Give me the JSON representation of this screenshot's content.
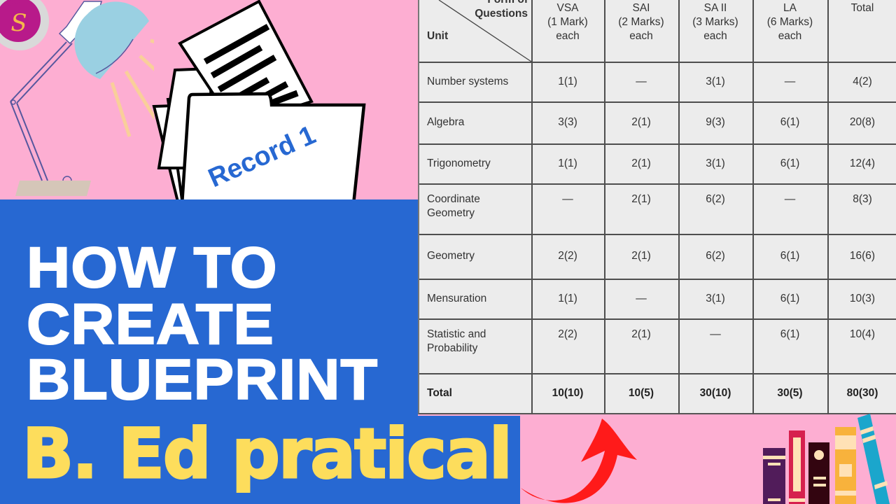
{
  "logo": {
    "letter": "S",
    "name": "channel-logo"
  },
  "folder_label": "Record 1",
  "headline": [
    "HOW TO",
    "CREATE",
    "BLUEPRINT"
  ],
  "subtitle": "B. Ed pratical",
  "colors": {
    "pink_background": "#fdaed2",
    "blue_panel": "#2768d2",
    "headline_text": "#ffffff",
    "subtitle_text": "#fddd5c",
    "folder_text": "#2768d2",
    "arrow": "#ff1a1a",
    "table_background": "#ececec"
  },
  "blueprint_table": {
    "corner_header": {
      "top": "Form of Questions",
      "top_line1": "Form of",
      "top_line2": "Questions",
      "bottom": "Unit"
    },
    "columns": [
      {
        "lines": [
          "VSA",
          "(1 Mark)",
          "each"
        ]
      },
      {
        "lines": [
          "SAI",
          "(2 Marks)",
          "each"
        ]
      },
      {
        "lines": [
          "SA II",
          "(3 Marks)",
          "each"
        ]
      },
      {
        "lines": [
          "LA",
          "(6 Marks)",
          "each"
        ]
      },
      {
        "lines": [
          "Total"
        ]
      }
    ],
    "rows": [
      {
        "unit": [
          "Number systems"
        ],
        "values": [
          "1(1)",
          "—",
          "3(1)",
          "—",
          "4(2)"
        ]
      },
      {
        "unit": [
          "Algebra"
        ],
        "values": [
          "3(3)",
          "2(1)",
          "9(3)",
          "6(1)",
          "20(8)"
        ]
      },
      {
        "unit": [
          "Trigonometry"
        ],
        "values": [
          "1(1)",
          "2(1)",
          "3(1)",
          "6(1)",
          "12(4)"
        ]
      },
      {
        "unit": [
          "Coordinate",
          "Geometry"
        ],
        "values": [
          "—",
          "2(1)",
          "6(2)",
          "—",
          "8(3)"
        ]
      },
      {
        "unit": [
          "Geometry"
        ],
        "values": [
          "2(2)",
          "2(1)",
          "6(2)",
          "6(1)",
          "16(6)"
        ]
      },
      {
        "unit": [
          "Mensuration"
        ],
        "values": [
          "1(1)",
          "—",
          "3(1)",
          "6(1)",
          "10(3)"
        ]
      },
      {
        "unit": [
          "Statistic and",
          "Probability"
        ],
        "values": [
          "2(2)",
          "2(1)",
          "—",
          "6(1)",
          "10(4)"
        ]
      }
    ],
    "total_row": {
      "unit": [
        "Total"
      ],
      "values": [
        "10(10)",
        "10(5)",
        "30(10)",
        "30(5)",
        "80(30)"
      ]
    }
  }
}
